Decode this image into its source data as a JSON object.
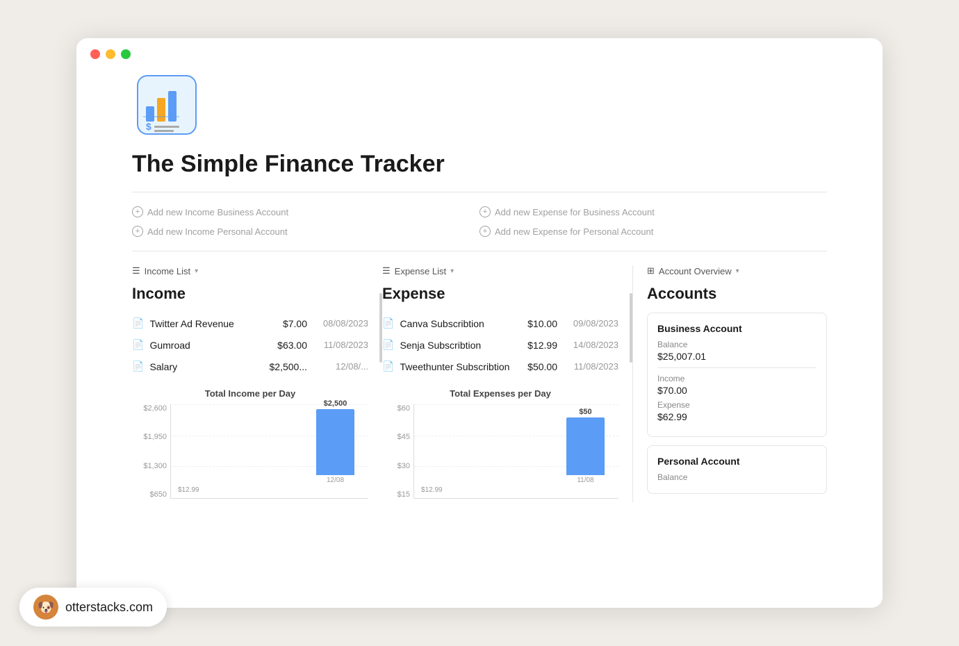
{
  "window": {
    "title": "The Simple Finance Tracker"
  },
  "titlebar": {
    "dots": [
      "red",
      "yellow",
      "green"
    ]
  },
  "page": {
    "title": "The Simple Finance Tracker"
  },
  "add_buttons": {
    "income_business": "Add new Income Business Account",
    "income_personal": "Add new Income Personal Account",
    "expense_business": "Add new Expense for Business Account",
    "expense_personal": "Add new Expense for Personal Account"
  },
  "income_panel": {
    "header": "Income List",
    "title": "Income",
    "transactions": [
      {
        "name": "Twitter Ad Revenue",
        "amount": "$7.00",
        "date": "08/08/2023"
      },
      {
        "name": "Gumroad",
        "amount": "$63.00",
        "date": "11/08/2023"
      },
      {
        "name": "Salary",
        "amount": "$2,500...",
        "date": "12/08/..."
      }
    ],
    "chart": {
      "title": "Total Income per Day",
      "y_labels": [
        "$2,600",
        "$1,950",
        "$1,300",
        "$650"
      ],
      "bar_value": "$2,500",
      "bar_x_label": "12/08",
      "x_label_low": "$12.99"
    }
  },
  "expense_panel": {
    "header": "Expense List",
    "title": "Expense",
    "transactions": [
      {
        "name": "Canva Subscribtion",
        "amount": "$10.00",
        "date": "09/08/2023"
      },
      {
        "name": "Senja Subscribtion",
        "amount": "$12.99",
        "date": "14/08/2023"
      },
      {
        "name": "Tweethunter Subscribtion",
        "amount": "$50.00",
        "date": "11/08/2023"
      }
    ],
    "chart": {
      "title": "Total Expenses per Day",
      "y_labels": [
        "$60",
        "$45",
        "$30",
        "$15"
      ],
      "bar_value": "$50",
      "bar_x_label": "11/08",
      "x_label_low": "$12.99"
    }
  },
  "accounts_panel": {
    "header": "Account Overview",
    "title": "Accounts",
    "accounts": [
      {
        "name": "Business Account",
        "balance_label": "Balance",
        "balance": "$25,007.01",
        "income_label": "Income",
        "income": "$70.00",
        "expense_label": "Expense",
        "expense": "$62.99"
      },
      {
        "name": "Personal Account",
        "balance_label": "Balance",
        "balance": "",
        "income_label": "",
        "income": "",
        "expense_label": "",
        "expense": ""
      }
    ]
  },
  "watermark": {
    "url": "otterstacks.com",
    "avatar": "🐶"
  }
}
